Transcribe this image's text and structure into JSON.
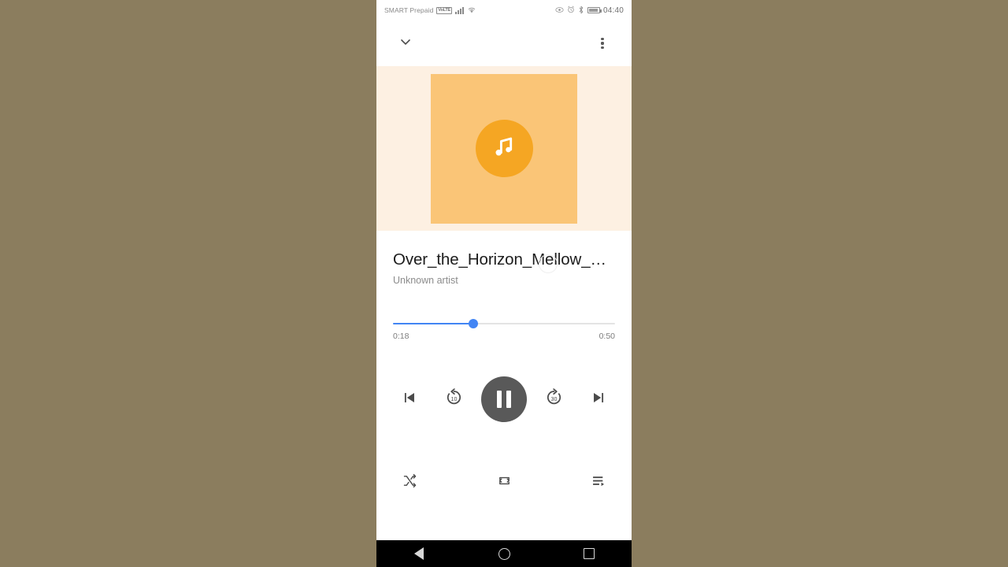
{
  "status_bar": {
    "carrier": "SMART Prepaid",
    "volte_badge": "VoLTE",
    "signal_icon": "signal-bars-icon",
    "wifi_icon": "wifi-icon",
    "eye_icon": "eye-comfort-icon",
    "alarm_icon": "alarm-clock-icon",
    "bluetooth_icon": "bluetooth-icon",
    "battery_icon": "battery-icon",
    "time": "04:40"
  },
  "app_bar": {
    "collapse_icon": "chevron-down-icon",
    "overflow_icon": "more-vertical-icon"
  },
  "album_art": {
    "placeholder_icon": "music-note-icon",
    "square_color": "#fac577",
    "circle_color": "#f5a623",
    "backdrop_color": "#fdf0e2"
  },
  "track": {
    "title": "Over_the_Horizon_Mellow_…",
    "artist": "Unknown artist"
  },
  "seek": {
    "current_time": "0:18",
    "total_time": "0:50",
    "progress_percent": 36,
    "accent_color": "#4285f4"
  },
  "transport": {
    "previous_label": "previous-track-icon",
    "rewind_label": "replay-10-icon",
    "rewind_seconds": "10",
    "play_pause_label": "pause-icon",
    "forward_label": "forward-30-icon",
    "forward_seconds": "30",
    "next_label": "next-track-icon",
    "play_button_color": "#595959"
  },
  "bottom_controls": {
    "shuffle_label": "shuffle-icon",
    "repeat_label": "repeat-icon",
    "queue_label": "playlist-queue-icon"
  },
  "nav_bar": {
    "back_label": "back-icon",
    "home_label": "home-icon",
    "recents_label": "recents-icon"
  }
}
